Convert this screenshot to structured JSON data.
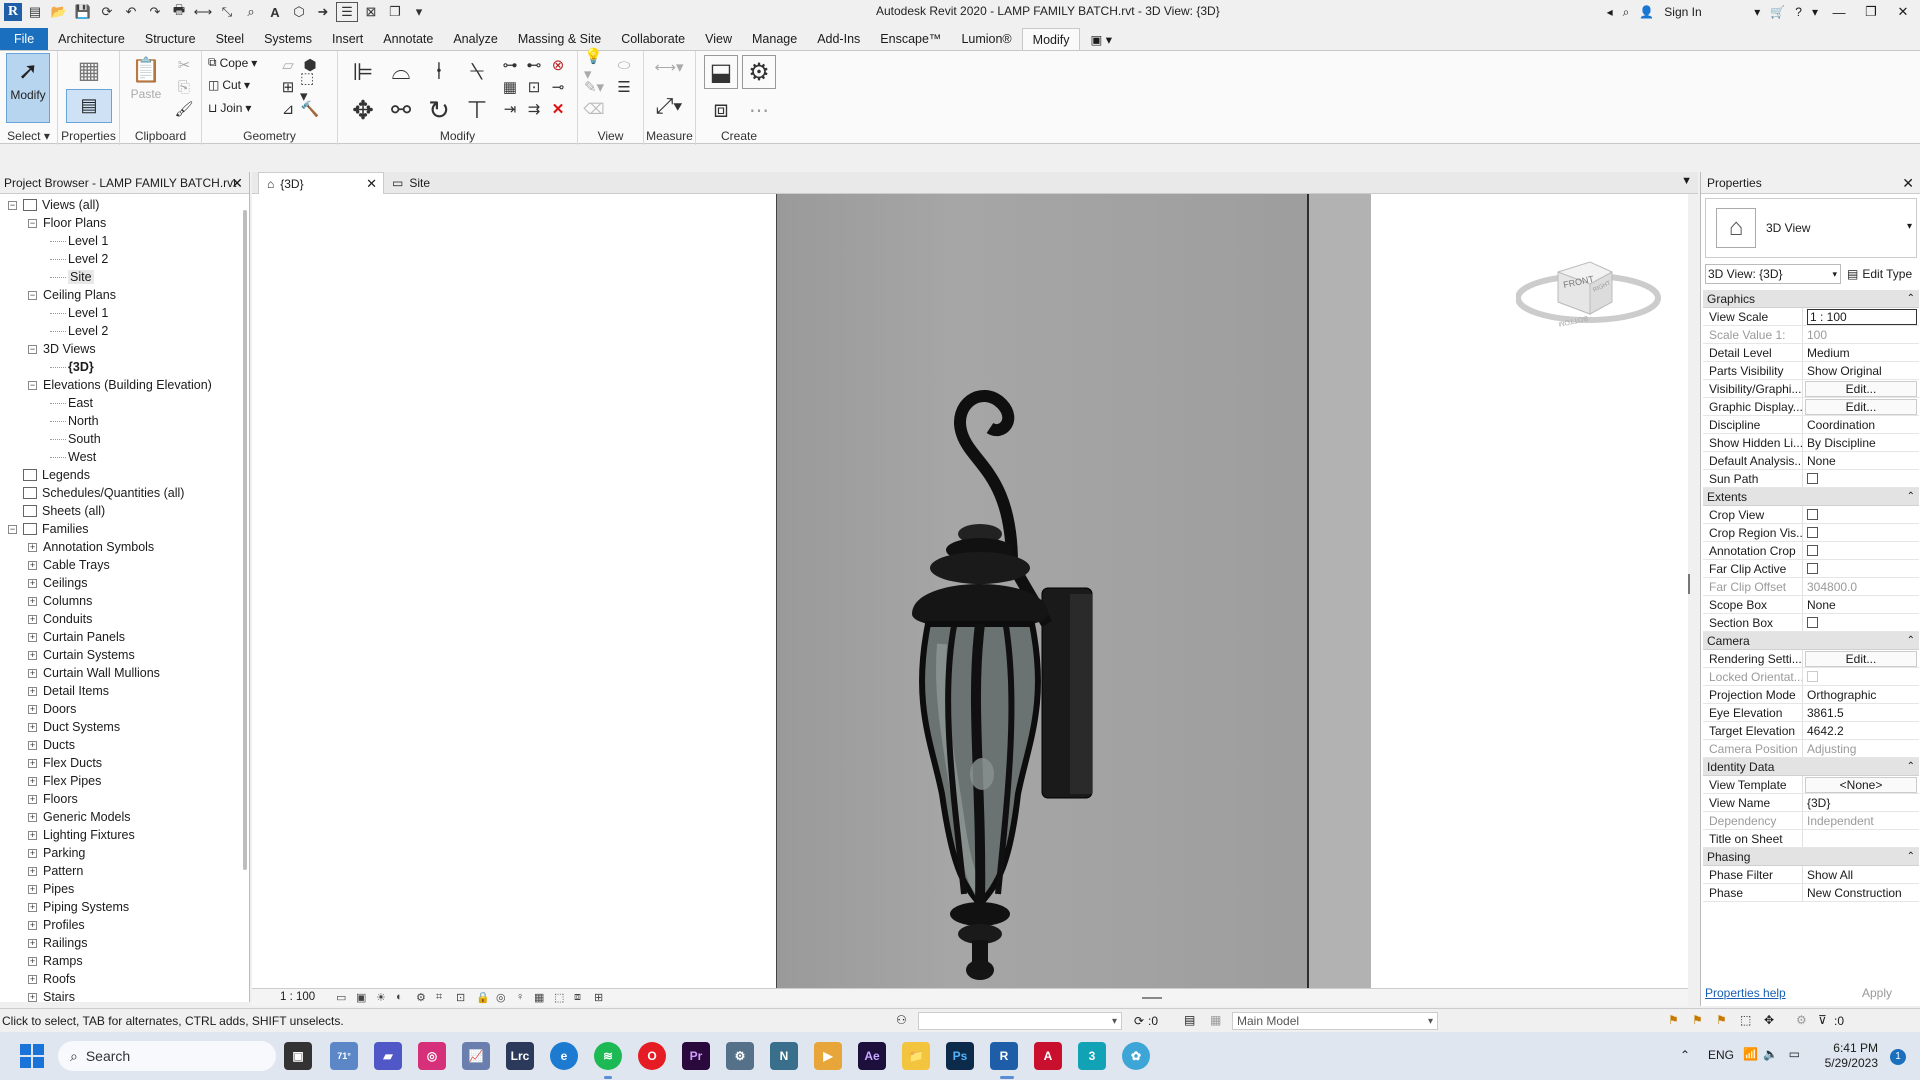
{
  "title": {
    "text": "Autodesk Revit 2020 - LAMP FAMILY BATCH.rvt - 3D View: {3D}",
    "sign_in": "Sign In"
  },
  "ribbon": {
    "tabs": [
      "File",
      "Architecture",
      "Structure",
      "Steel",
      "Systems",
      "Insert",
      "Annotate",
      "Analyze",
      "Massing & Site",
      "Collaborate",
      "View",
      "Manage",
      "Add-Ins",
      "Enscape™",
      "Lumion®",
      "Modify"
    ],
    "active_tab": "Modify",
    "modify_label": "Modify",
    "select_label": "Select",
    "properties_label": "Properties",
    "paste_label": "Paste",
    "clipboard_label": "Clipboard",
    "cope_label": "Cope",
    "cut_label": "Cut",
    "join_label": "Join",
    "geometry_label": "Geometry",
    "modify_group_label": "Modify",
    "view_label": "View",
    "measure_label": "Measure",
    "create_label": "Create"
  },
  "browser": {
    "title": "Project Browser - LAMP FAMILY BATCH.rvt",
    "nodes": [
      {
        "label": "Views (all)"
      },
      {
        "label": "Floor Plans"
      },
      {
        "label": "Level 1"
      },
      {
        "label": "Level 2"
      },
      {
        "label": "Site"
      },
      {
        "label": "Ceiling Plans"
      },
      {
        "label": "Level 1"
      },
      {
        "label": "Level 2"
      },
      {
        "label": "3D Views"
      },
      {
        "label": "{3D}"
      },
      {
        "label": "Elevations (Building Elevation)"
      },
      {
        "label": "East"
      },
      {
        "label": "North"
      },
      {
        "label": "South"
      },
      {
        "label": "West"
      },
      {
        "label": "Legends"
      },
      {
        "label": "Schedules/Quantities (all)"
      },
      {
        "label": "Sheets (all)"
      },
      {
        "label": "Families"
      },
      {
        "label": "Annotation Symbols"
      },
      {
        "label": "Cable Trays"
      },
      {
        "label": "Ceilings"
      },
      {
        "label": "Columns"
      },
      {
        "label": "Conduits"
      },
      {
        "label": "Curtain Panels"
      },
      {
        "label": "Curtain Systems"
      },
      {
        "label": "Curtain Wall Mullions"
      },
      {
        "label": "Detail Items"
      },
      {
        "label": "Doors"
      },
      {
        "label": "Duct Systems"
      },
      {
        "label": "Ducts"
      },
      {
        "label": "Flex Ducts"
      },
      {
        "label": "Flex Pipes"
      },
      {
        "label": "Floors"
      },
      {
        "label": "Generic Models"
      },
      {
        "label": "Lighting Fixtures"
      },
      {
        "label": "Parking"
      },
      {
        "label": "Pattern"
      },
      {
        "label": "Pipes"
      },
      {
        "label": "Piping Systems"
      },
      {
        "label": "Profiles"
      },
      {
        "label": "Railings"
      },
      {
        "label": "Ramps"
      },
      {
        "label": "Roofs"
      },
      {
        "label": "Stairs"
      }
    ]
  },
  "view_tabs": [
    {
      "label": "{3D}"
    },
    {
      "label": "Site"
    }
  ],
  "view_control": {
    "scale": "1 : 100"
  },
  "viewcube": {
    "front": "FRONT",
    "right": "RIGHT",
    "bottom": "BOTTOM"
  },
  "properties": {
    "title": "Properties",
    "type_name": "3D View",
    "instance": "3D View: {3D}",
    "edit_type": "Edit Type",
    "sections": [
      {
        "name": "Graphics",
        "rows": [
          {
            "name": "View Scale",
            "value": "1 : 100"
          },
          {
            "name": "Scale Value    1:",
            "value": "100"
          },
          {
            "name": "Detail Level",
            "value": "Medium"
          },
          {
            "name": "Parts Visibility",
            "value": "Show Original"
          },
          {
            "name": "Visibility/Graphi...",
            "value": "Edit..."
          },
          {
            "name": "Graphic Display...",
            "value": "Edit..."
          },
          {
            "name": "Discipline",
            "value": "Coordination"
          },
          {
            "name": "Show Hidden Li...",
            "value": "By Discipline"
          },
          {
            "name": "Default Analysis...",
            "value": "None"
          },
          {
            "name": "Sun Path",
            "value": ""
          }
        ]
      },
      {
        "name": "Extents",
        "rows": [
          {
            "name": "Crop View",
            "value": ""
          },
          {
            "name": "Crop Region Vis...",
            "value": ""
          },
          {
            "name": "Annotation Crop",
            "value": ""
          },
          {
            "name": "Far Clip Active",
            "value": ""
          },
          {
            "name": "Far Clip Offset",
            "value": "304800.0"
          },
          {
            "name": "Scope Box",
            "value": "None"
          },
          {
            "name": "Section Box",
            "value": ""
          }
        ]
      },
      {
        "name": "Camera",
        "rows": [
          {
            "name": "Rendering Setti...",
            "value": "Edit..."
          },
          {
            "name": "Locked Orientat...",
            "value": ""
          },
          {
            "name": "Projection Mode",
            "value": "Orthographic"
          },
          {
            "name": "Eye Elevation",
            "value": "3861.5"
          },
          {
            "name": "Target Elevation",
            "value": "4642.2"
          },
          {
            "name": "Camera Position",
            "value": "Adjusting"
          }
        ]
      },
      {
        "name": "Identity Data",
        "rows": [
          {
            "name": "View Template",
            "value": "<None>"
          },
          {
            "name": "View Name",
            "value": "{3D}"
          },
          {
            "name": "Dependency",
            "value": "Independent"
          },
          {
            "name": "Title on Sheet",
            "value": ""
          }
        ]
      },
      {
        "name": "Phasing",
        "rows": [
          {
            "name": "Phase Filter",
            "value": "Show All"
          },
          {
            "name": "Phase",
            "value": "New Construction"
          }
        ]
      }
    ],
    "help": "Properties help",
    "apply": "Apply"
  },
  "status": {
    "text": "Click to select, TAB for alternates, CTRL adds, SHIFT unselects.",
    "worksets_count": ":0",
    "model": "Main Model",
    "filter_count": ":0"
  },
  "taskbar": {
    "search": "Search",
    "weather": "71°",
    "lang": "ENG",
    "time": "6:41 PM",
    "date": "5/29/2023",
    "notif": "1"
  }
}
